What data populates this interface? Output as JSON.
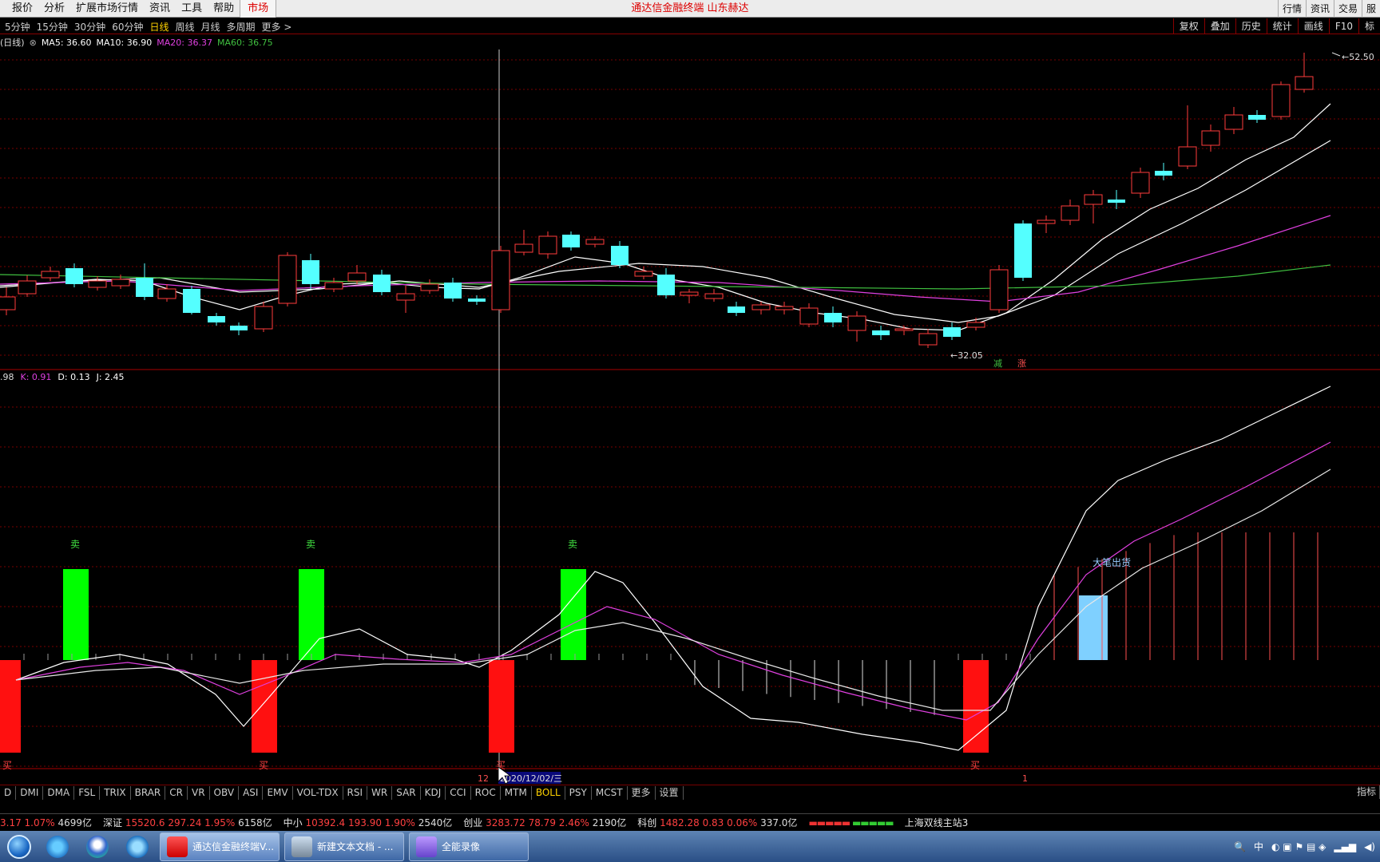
{
  "menu": {
    "items": [
      "报价",
      "分析",
      "扩展市场行情",
      "资讯",
      "工具",
      "帮助"
    ],
    "active": "市场",
    "title": "通达信金融终端  山东赫达",
    "right": [
      "行情",
      "资讯",
      "交易"
    ],
    "right_cut": "服"
  },
  "periods": {
    "items": [
      "5分钟",
      "15分钟",
      "30分钟",
      "60分钟",
      "日线",
      "周线",
      "月线",
      "多周期",
      "更多 >"
    ],
    "selected": "日线",
    "tools": [
      "复权",
      "叠加",
      "历史",
      "统计",
      "画线",
      "F10"
    ],
    "tools_cut": "标"
  },
  "ma_legend": {
    "period": "(日线)",
    "ma5": "MA5: 36.60",
    "ma10": "MA10: 36.90",
    "ma20": "MA20: 36.37",
    "ma60": "MA60: 36.75",
    "colors": {
      "ma5": "#ffffff",
      "ma10": "#ffffff",
      "ma20": "#e040e0",
      "ma60": "#40c040"
    }
  },
  "kdj_legend": {
    "prefix": ".98",
    "k": "K: 0.91",
    "d": "D: 0.13",
    "j": "J: 2.45"
  },
  "price_labels": {
    "high": "52.50",
    "low": "32.05",
    "sig_down": "减",
    "sig_up": "涨"
  },
  "indicator_labels": {
    "sell": "卖",
    "buy": "买",
    "big_exit": "大笔出货"
  },
  "axis": {
    "tick_12": "12",
    "cursor_date": "2020/12/02/三",
    "tick_1": "1"
  },
  "indicator_tabs": {
    "items": [
      "D",
      "DMI",
      "DMA",
      "FSL",
      "TRIX",
      "BRAR",
      "CR",
      "VR",
      "OBV",
      "ASI",
      "EMV",
      "VOL-TDX",
      "RSI",
      "WR",
      "SAR",
      "KDJ",
      "CCI",
      "ROC",
      "MTM",
      "BOLL",
      "PSY",
      "MCST",
      "更多",
      "设置"
    ],
    "right": "指标"
  },
  "index_bar": {
    "sh": {
      "val": "3.17",
      "pct": "1.07%",
      "amt": "4699亿"
    },
    "sz": {
      "name": "深证",
      "val": "15520.6",
      "chg": "297.24",
      "pct": "1.95%",
      "amt": "6158亿"
    },
    "zx": {
      "name": "中小",
      "val": "10392.4",
      "chg": "193.90",
      "pct": "1.90%",
      "amt": "2540亿"
    },
    "cy": {
      "name": "创业",
      "val": "3283.72",
      "chg": "78.79",
      "pct": "2.46%",
      "amt": "2190亿"
    },
    "kc": {
      "name": "科创",
      "val": "1482.28",
      "chg": "0.83",
      "pct": "0.06%",
      "amt": "337.0亿"
    },
    "station": "上海双线主站3"
  },
  "taskbar": {
    "tasks": [
      "通达信金融终端V...",
      "新建文本文档 - ...",
      "全能录像"
    ],
    "ime": "中"
  },
  "chart_data": {
    "type": "candlestick",
    "price_high_label": 52.5,
    "price_low_label": 32.05
  }
}
